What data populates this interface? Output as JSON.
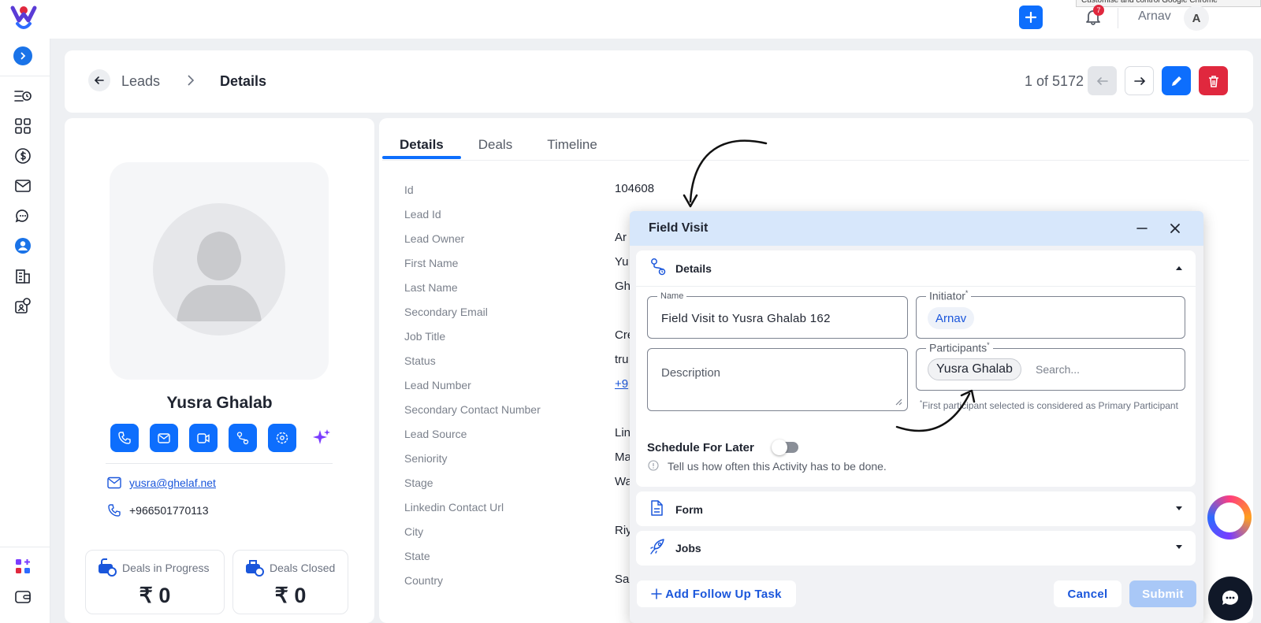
{
  "topbar": {
    "user_name": "Arnav",
    "user_initial": "A",
    "notification_count": "7",
    "tooltip_text": "Customise and control Google Chrome"
  },
  "sidebar": {
    "items": [
      "activity-list",
      "dashboard",
      "deals",
      "mail",
      "chat",
      "contacts",
      "company",
      "settings-people",
      "apps",
      "wallet"
    ]
  },
  "header": {
    "crumb_leads": "Leads",
    "crumb_details": "Details",
    "pager": "1 of 5172"
  },
  "profile": {
    "name": "Yusra Ghalab",
    "email": "yusra@ghelaf.net",
    "phone": "+966501770113",
    "stats": [
      {
        "label": "Deals in Progress",
        "value": "₹ 0"
      },
      {
        "label": "Deals Closed",
        "value": "₹ 0"
      }
    ]
  },
  "tabs": [
    "Details",
    "Deals",
    "Timeline"
  ],
  "fields": [
    {
      "label": "Id",
      "value": "104608"
    },
    {
      "label": "Lead Id",
      "value": ""
    },
    {
      "label": "Lead Owner",
      "value": "Ar"
    },
    {
      "label": "First Name",
      "value": "Yu"
    },
    {
      "label": "Last Name",
      "value": "Gh"
    },
    {
      "label": "Secondary Email",
      "value": ""
    },
    {
      "label": "Job Title",
      "value": "Cre"
    },
    {
      "label": "Status",
      "value": "tru"
    },
    {
      "label": "Lead Number",
      "value": "+9"
    },
    {
      "label": "Secondary Contact Number",
      "value": ""
    },
    {
      "label": "Lead Source",
      "value": "Lin"
    },
    {
      "label": "Seniority",
      "value": "Ma"
    },
    {
      "label": "Stage",
      "value": "Wa"
    },
    {
      "label": "Linkedin Contact Url",
      "value": ""
    },
    {
      "label": "City",
      "value": "Riy"
    },
    {
      "label": "State",
      "value": ""
    },
    {
      "label": "Country",
      "value": "Sa"
    }
  ],
  "modal": {
    "title": "Field Visit",
    "details_section": "Details",
    "name_label": "Name",
    "name_value": "Field Visit to Yusra Ghalab 162",
    "initiator_label": "Initiator",
    "initiator_value": "Arnav",
    "description_placeholder": "Description",
    "participants_label": "Participants",
    "participant_chip": "Yusra Ghalab",
    "participants_search_placeholder": "Search...",
    "required_mark": "*",
    "primary_hint": "First participant selected is considered as Primary Participant",
    "schedule_label": "Schedule For Later",
    "schedule_hint": "Tell us how often this Activity has to be done.",
    "form_section": "Form",
    "jobs_section": "Jobs",
    "add_follow_up": "Add Follow Up Task",
    "cancel": "Cancel",
    "submit": "Submit"
  },
  "colors": {
    "primary": "#0d6efd",
    "danger": "#e0283e",
    "modal_header": "#d7e7fb",
    "submit_disabled": "#a9c8f7"
  }
}
